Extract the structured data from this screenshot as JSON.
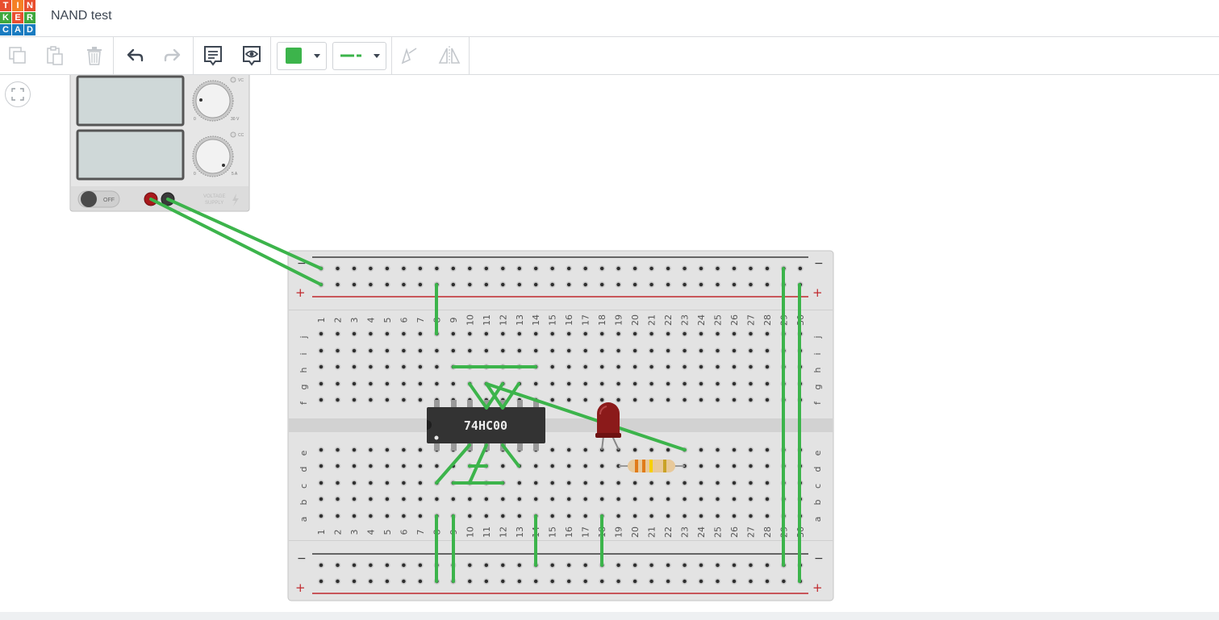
{
  "app": {
    "logo_letters": [
      "T",
      "I",
      "N",
      "K",
      "E",
      "R",
      "C",
      "A",
      "D"
    ],
    "logo_colors": [
      "#e84f2f",
      "#f58025",
      "#e84f2f",
      "#3fa73d",
      "#e84f2f",
      "#3fa73d",
      "#1a7cc1",
      "#1a7cc1",
      "#1a7cc1"
    ],
    "title": "NAND test"
  },
  "toolbar": {
    "buttons": [
      "copy-icon",
      "paste-icon",
      "delete-icon",
      "undo-icon",
      "redo-icon",
      "notes-icon",
      "notes-visibility-icon",
      "color-swatch",
      "wire-type",
      "flip-icon",
      "mirror-icon"
    ],
    "wire_color": "#3cb44b"
  },
  "power_supply": {
    "voltage_tick_min": "0",
    "voltage_tick_max": "30 V",
    "current_tick_min": "0",
    "current_tick_max": "5 A",
    "vc_label": "VC",
    "cc_label": "CC",
    "switch_label": "OFF",
    "brand_line1": "VOLTAGE",
    "brand_line2": "SUPPLY"
  },
  "breadboard": {
    "columns": [
      "1",
      "2",
      "3",
      "4",
      "5",
      "6",
      "7",
      "8",
      "9",
      "10",
      "11",
      "12",
      "13",
      "14",
      "15",
      "16",
      "17",
      "18",
      "19",
      "20",
      "21",
      "22",
      "23",
      "24",
      "25",
      "26",
      "27",
      "28",
      "29",
      "30"
    ],
    "top_rows": [
      "j",
      "i",
      "h",
      "g",
      "f"
    ],
    "bottom_rows": [
      "e",
      "d",
      "c",
      "b",
      "a"
    ],
    "minus": "−",
    "plus": "+"
  },
  "chip": {
    "label": "74HC00"
  },
  "colors": {
    "wire": "#3cb44b",
    "rail_red": "#c0282d",
    "rail_black": "#3a3a3a",
    "led": "#8b1a1a",
    "board": "#e3e3e3"
  }
}
